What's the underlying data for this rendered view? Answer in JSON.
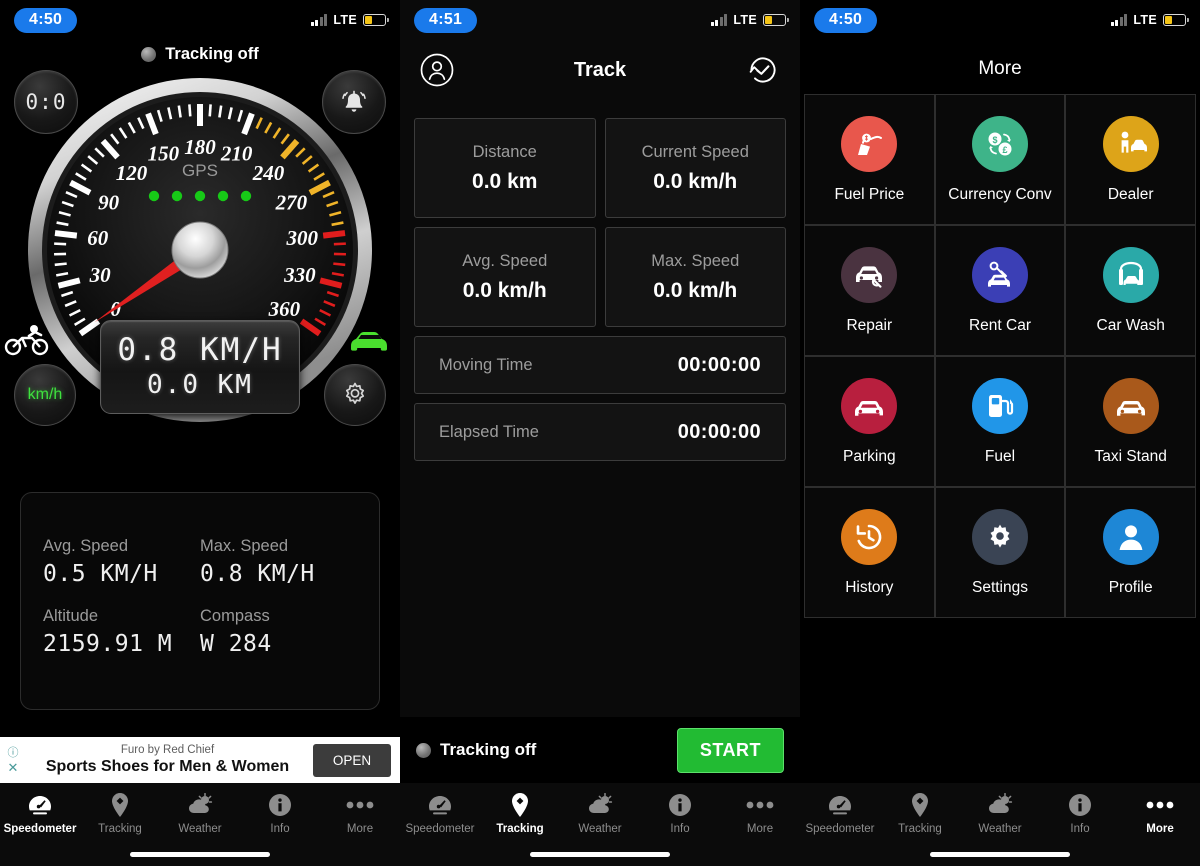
{
  "status_bar": {
    "time_left": "4:50",
    "time_mid": "4:51",
    "time_right": "4:50",
    "network": "LTE"
  },
  "speedometer": {
    "tracking_label": "Tracking off",
    "timer_button": "0:0",
    "unit_button": "km/h",
    "gps_label": "GPS",
    "gps_dots": 5,
    "dial_labels": [
      "0",
      "30",
      "60",
      "90",
      "120",
      "150",
      "180",
      "210",
      "240",
      "270",
      "300",
      "330",
      "360"
    ],
    "dial_min": 0,
    "dial_max": 360,
    "needle_value": 0.8,
    "lcd_speed": "0.8 KM/H",
    "lcd_distance": "0.0 KM",
    "stats": [
      {
        "label": "Avg. Speed",
        "value": "0.5 KM/H"
      },
      {
        "label": "Max. Speed",
        "value": "0.8 KM/H"
      },
      {
        "label": "Altitude",
        "value": "2159.91 M"
      },
      {
        "label": "Compass",
        "value": "W 284"
      }
    ]
  },
  "ad": {
    "advertiser": "Furo by Red Chief",
    "headline": "Sports Shoes for Men & Women",
    "cta": "OPEN"
  },
  "track": {
    "nav_title": "Track",
    "cards": [
      {
        "label": "Distance",
        "value": "0.0 km"
      },
      {
        "label": "Current Speed",
        "value": "0.0 km/h"
      },
      {
        "label": "Avg. Speed",
        "value": "0.0 km/h"
      },
      {
        "label": "Max. Speed",
        "value": "0.0 km/h"
      }
    ],
    "rows": [
      {
        "label": "Moving Time",
        "value": "00:00:00"
      },
      {
        "label": "Elapsed Time",
        "value": "00:00:00"
      }
    ],
    "tracking_label": "Tracking off",
    "start_button": "START"
  },
  "more": {
    "title": "More",
    "items": [
      {
        "label": "Fuel Price",
        "icon": "fuel-price-icon",
        "color": "#E8574C"
      },
      {
        "label": "Currency Conv",
        "icon": "currency-icon",
        "color": "#3EB489"
      },
      {
        "label": "Dealer",
        "icon": "dealer-icon",
        "color": "#DDA419"
      },
      {
        "label": "Repair",
        "icon": "repair-icon",
        "color": "#4A3340"
      },
      {
        "label": "Rent Car",
        "icon": "rent-car-icon",
        "color": "#3B3FB5"
      },
      {
        "label": "Car Wash",
        "icon": "car-wash-icon",
        "color": "#2AA9A8"
      },
      {
        "label": "Parking",
        "icon": "parking-icon",
        "color": "#B81F3E"
      },
      {
        "label": "Fuel",
        "icon": "fuel-icon",
        "color": "#2196E8"
      },
      {
        "label": "Taxi Stand",
        "icon": "taxi-stand-icon",
        "color": "#A9591B"
      },
      {
        "label": "History",
        "icon": "history-icon",
        "color": "#DE7B1A"
      },
      {
        "label": "Settings",
        "icon": "settings-icon",
        "color": "#3A4454"
      },
      {
        "label": "Profile",
        "icon": "profile-icon",
        "color": "#1E87D6"
      }
    ]
  },
  "tabs": [
    {
      "label": "Speedometer",
      "icon": "speedometer-icon"
    },
    {
      "label": "Tracking",
      "icon": "location-pin-icon"
    },
    {
      "label": "Weather",
      "icon": "cloud-sun-icon"
    },
    {
      "label": "Info",
      "icon": "info-icon"
    },
    {
      "label": "More",
      "icon": "ellipsis-icon"
    }
  ],
  "active_tab": {
    "left": "Speedometer",
    "mid": "Tracking",
    "right": "More"
  }
}
